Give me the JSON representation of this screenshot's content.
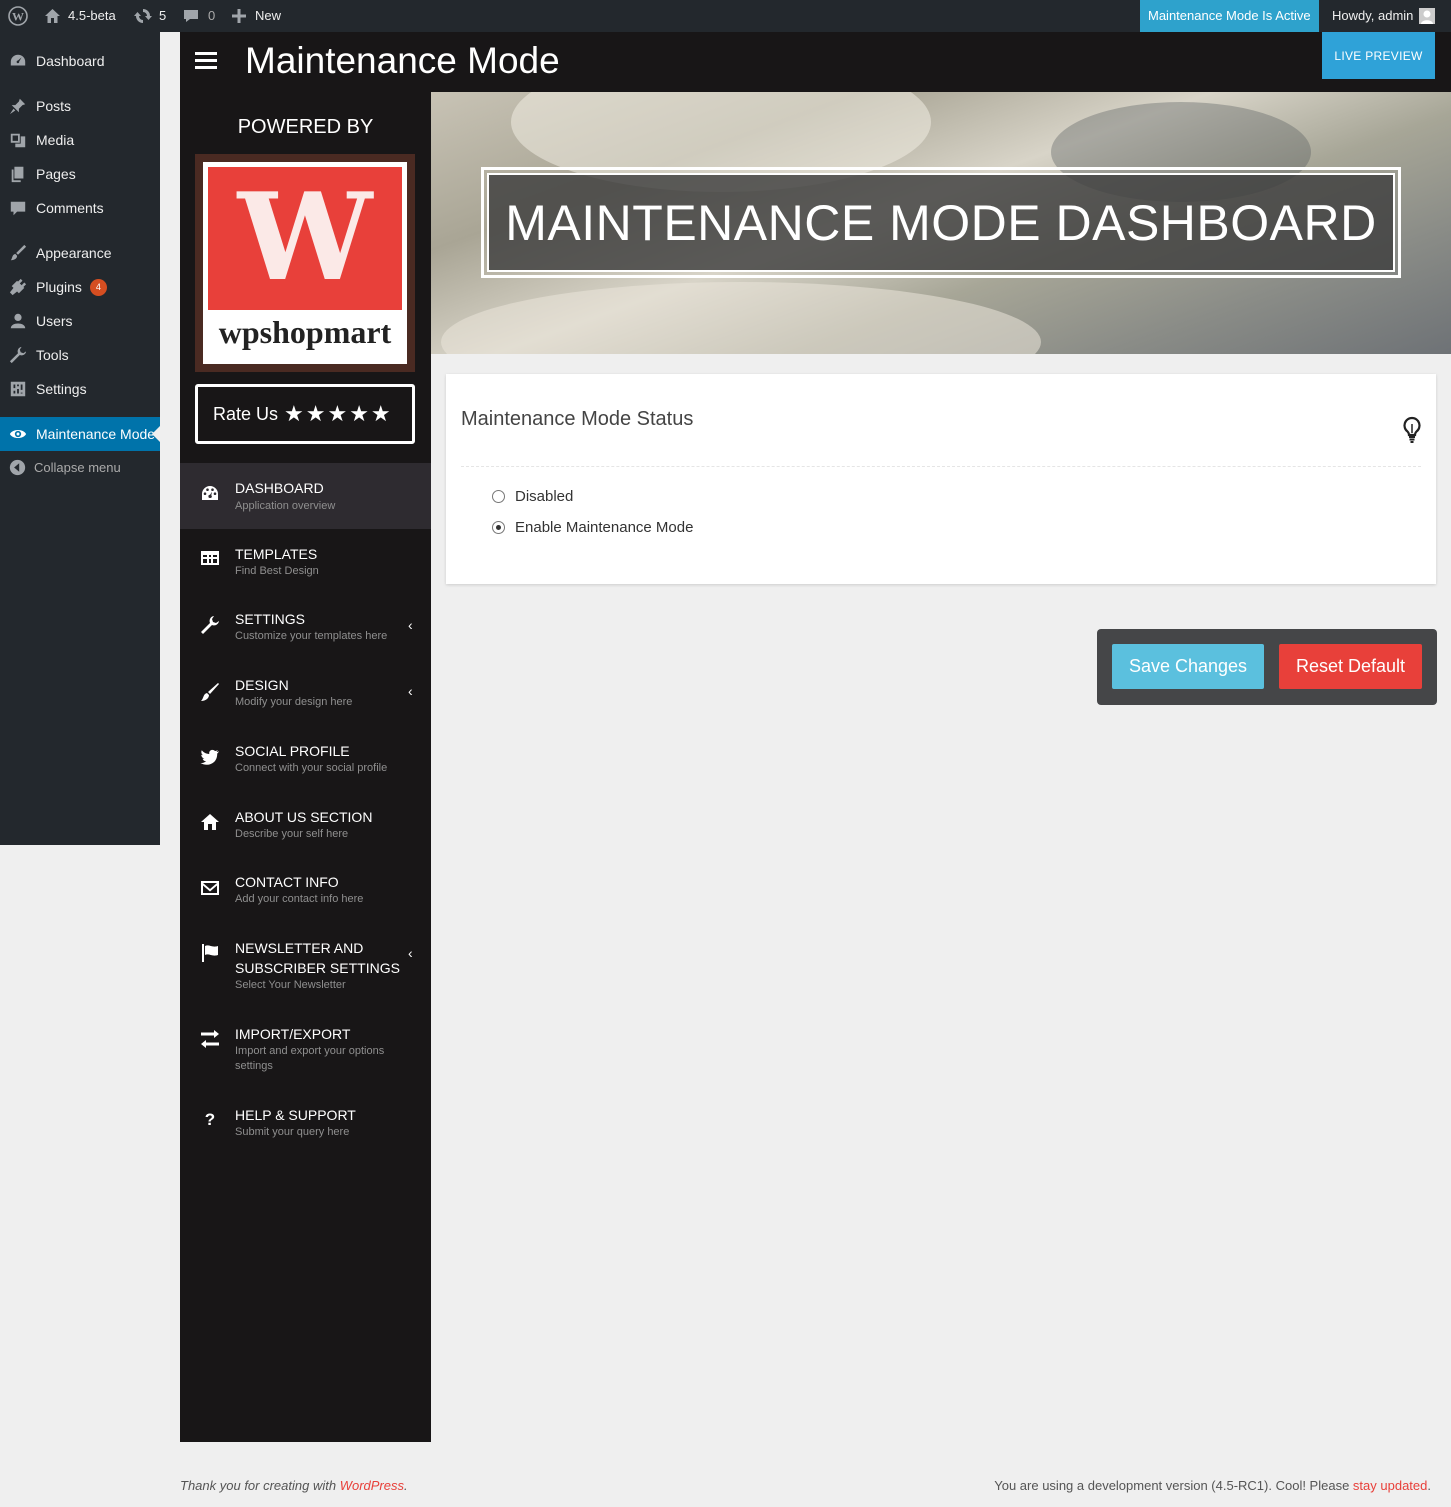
{
  "adminbar": {
    "site_name": "4.5-beta",
    "updates_count": "5",
    "comments_count": "0",
    "new_label": "New",
    "maintenance_status": "Maintenance Mode Is Active",
    "howdy": "Howdy, admin"
  },
  "wp_menu": {
    "items": [
      {
        "label": "Dashboard",
        "icon": "dashboard-icon"
      },
      {
        "label": "Posts",
        "icon": "pin-icon"
      },
      {
        "label": "Media",
        "icon": "media-icon"
      },
      {
        "label": "Pages",
        "icon": "pages-icon"
      },
      {
        "label": "Comments",
        "icon": "comment-icon"
      },
      {
        "label": "Appearance",
        "icon": "brush-icon"
      },
      {
        "label": "Plugins",
        "icon": "plug-icon",
        "badge": "4"
      },
      {
        "label": "Users",
        "icon": "user-icon"
      },
      {
        "label": "Tools",
        "icon": "wrench-icon"
      },
      {
        "label": "Settings",
        "icon": "settings-icon"
      },
      {
        "label": "Maintenance Mode",
        "icon": "eye-icon",
        "current": true
      }
    ],
    "collapse_label": "Collapse menu"
  },
  "plugin_header": {
    "title": "Maintenance Mode",
    "live_preview": "LIVE PREVIEW"
  },
  "plugin_sidebar": {
    "powered_by": "POWERED BY",
    "logo_letter": "W",
    "logo_wordmark": "wpshopmart",
    "rate_us": "Rate Us",
    "stars": "★★★★★",
    "menu": [
      {
        "title": "DASHBOARD",
        "subtitle": "Application overview",
        "icon": "palette-icon",
        "active": true
      },
      {
        "title": "TEMPLATES",
        "subtitle": "Find Best Design",
        "icon": "grid-icon"
      },
      {
        "title": "SETTINGS",
        "subtitle": "Customize your templates here",
        "icon": "wrench-icon",
        "chevron": "‹"
      },
      {
        "title": "DESIGN",
        "subtitle": "Modify your design here",
        "icon": "paintbrush-icon",
        "chevron": "‹"
      },
      {
        "title": "SOCIAL PROFILE",
        "subtitle": "Connect with your social profile",
        "icon": "twitter-icon"
      },
      {
        "title": "ABOUT US SECTION",
        "subtitle": "Describe your self here",
        "icon": "home-icon"
      },
      {
        "title": "CONTACT INFO",
        "subtitle": "Add your contact info here",
        "icon": "envelope-icon"
      },
      {
        "title": "NEWSLETTER AND SUBSCRIBER SETTINGS",
        "subtitle": "Select Your Newsletter",
        "icon": "flag-icon",
        "chevron": "‹"
      },
      {
        "title": "IMPORT/EXPORT",
        "subtitle": "Import and export your options settings",
        "icon": "exchange-icon"
      },
      {
        "title": "HELP & SUPPORT",
        "subtitle": "Submit your query here",
        "icon": "question-icon"
      }
    ]
  },
  "hero": {
    "heading": "MAINTENANCE MODE DASHBOARD"
  },
  "status_panel": {
    "title": "Maintenance Mode Status",
    "options": [
      {
        "label": "Disabled",
        "checked": false
      },
      {
        "label": "Enable Maintenance Mode",
        "checked": true
      }
    ]
  },
  "actions": {
    "save": "Save Changes",
    "reset": "Reset Default"
  },
  "footer": {
    "left_prefix": "Thank you for creating with ",
    "left_link": "WordPress",
    "left_suffix": ".",
    "right_prefix": "You are using a development version (4.5-RC1). Cool! Please ",
    "right_link": "stay updated",
    "right_suffix": "."
  },
  "colors": {
    "accent_blue": "#2fa2d8",
    "save_button": "#5bc0de",
    "reset_button": "#e8403a",
    "wp_admin_dark": "#23282d",
    "plugin_dark": "#181617",
    "wp_current_menu": "#0073aa"
  }
}
